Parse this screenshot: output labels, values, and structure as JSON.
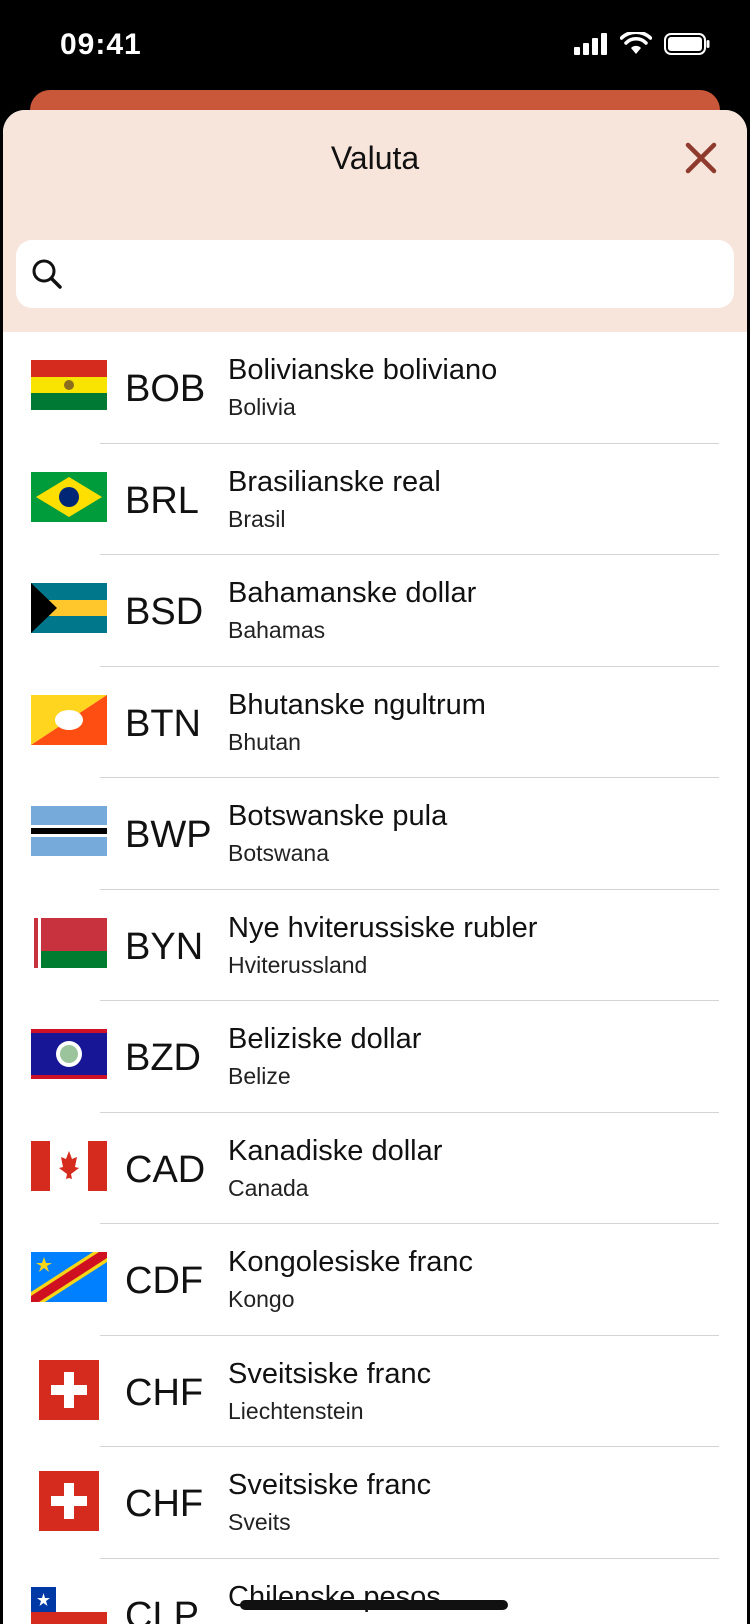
{
  "status": {
    "time": "09:41"
  },
  "sheet": {
    "title": "Valuta",
    "search_placeholder": ""
  },
  "colors": {
    "accent": "#C9573A",
    "header_bg": "#F7E5DB",
    "close": "#8E3A2C"
  },
  "currencies": [
    {
      "code": "BOB",
      "name": "Bolivianske boliviano",
      "country": "Bolivia",
      "flag": "bolivia-flag-icon"
    },
    {
      "code": "BRL",
      "name": "Brasilianske real",
      "country": "Brasil",
      "flag": "brazil-flag-icon"
    },
    {
      "code": "BSD",
      "name": "Bahamanske dollar",
      "country": "Bahamas",
      "flag": "bahamas-flag-icon"
    },
    {
      "code": "BTN",
      "name": "Bhutanske ngultrum",
      "country": "Bhutan",
      "flag": "bhutan-flag-icon"
    },
    {
      "code": "BWP",
      "name": "Botswanske pula",
      "country": "Botswana",
      "flag": "botswana-flag-icon"
    },
    {
      "code": "BYN",
      "name": "Nye hviterussiske rubler",
      "country": "Hviterussland",
      "flag": "belarus-flag-icon"
    },
    {
      "code": "BZD",
      "name": "Beliziske dollar",
      "country": "Belize",
      "flag": "belize-flag-icon"
    },
    {
      "code": "CAD",
      "name": "Kanadiske dollar",
      "country": "Canada",
      "flag": "canada-flag-icon"
    },
    {
      "code": "CDF",
      "name": "Kongolesiske franc",
      "country": "Kongo",
      "flag": "congo-flag-icon"
    },
    {
      "code": "CHF",
      "name": "Sveitsiske franc",
      "country": "Liechtenstein",
      "flag": "switzerland-flag-icon"
    },
    {
      "code": "CHF",
      "name": "Sveitsiske franc",
      "country": "Sveits",
      "flag": "switzerland-flag-icon"
    },
    {
      "code": "CLP",
      "name": "Chilenske pesos",
      "country": "",
      "flag": "chile-flag-icon"
    }
  ]
}
